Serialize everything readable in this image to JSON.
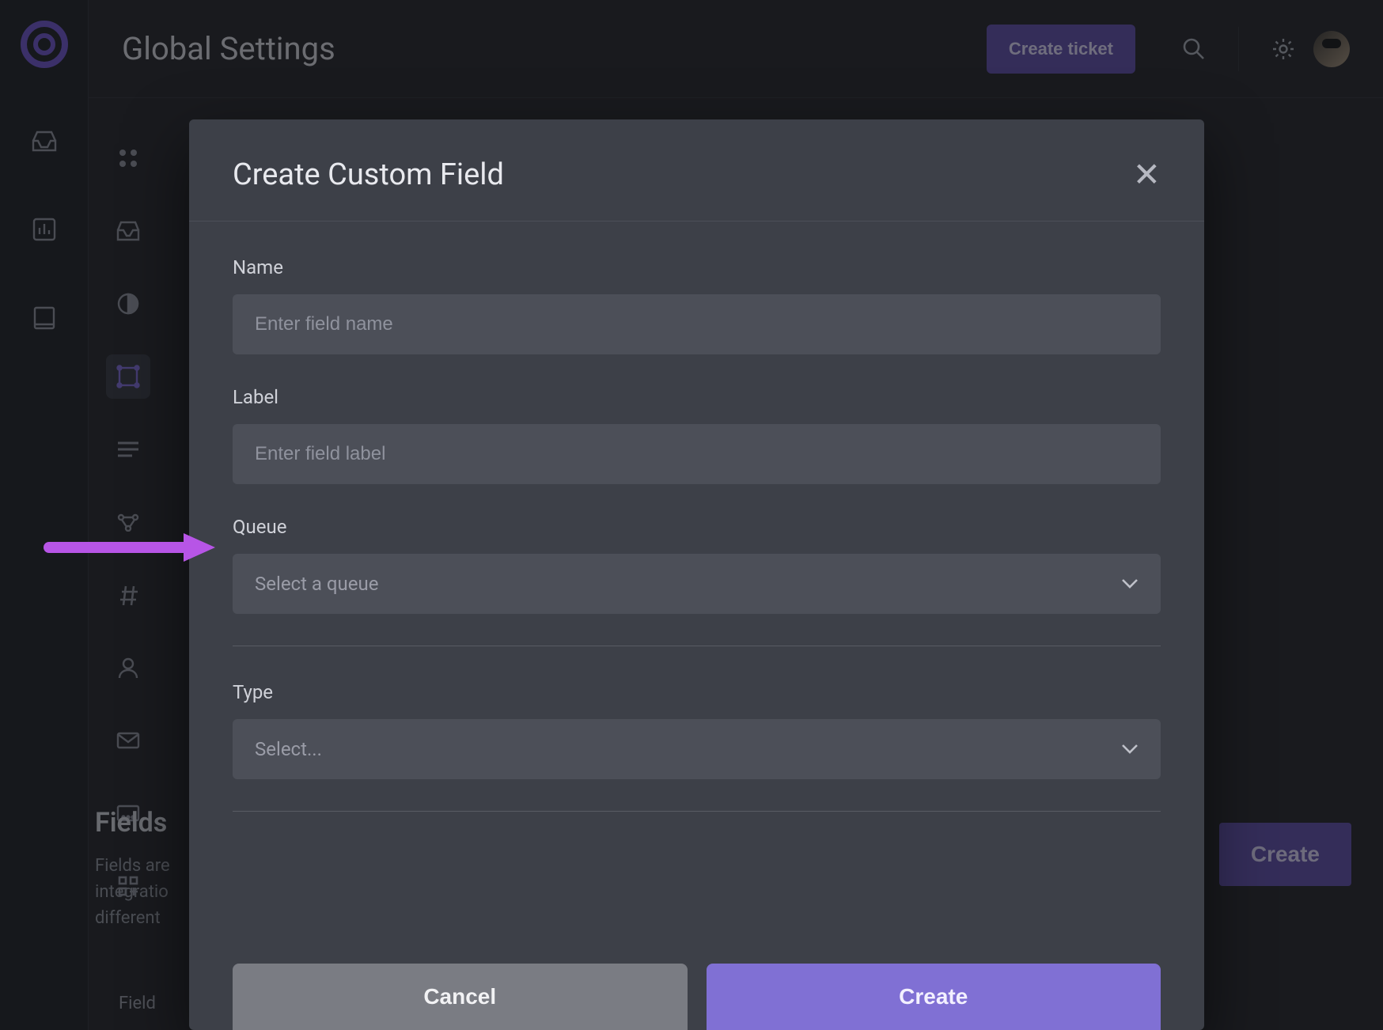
{
  "header": {
    "page_title": "Global Settings",
    "create_ticket_label": "Create ticket"
  },
  "background_page": {
    "section_title": "Fields",
    "section_body_line1": "Fields are",
    "section_body_line2": "integratio",
    "section_body_line3": "different",
    "create_button_label": "Create",
    "table_first_col": "Field"
  },
  "settings_nav_icons": [
    "apps-icon",
    "tray-icon",
    "contrast-icon",
    "fields-icon",
    "list-icon",
    "workflow-icon",
    "hash-icon",
    "user-icon",
    "mail-icon",
    "form-icon",
    "add-app-icon"
  ],
  "modal": {
    "title": "Create Custom Field",
    "labels": {
      "name": "Name",
      "label": "Label",
      "queue": "Queue",
      "type": "Type"
    },
    "placeholders": {
      "name": "Enter field name",
      "label": "Enter field label",
      "queue": "Select a queue",
      "type": "Select..."
    },
    "values": {
      "name": "",
      "label": "",
      "queue": "",
      "type": ""
    },
    "buttons": {
      "cancel": "Cancel",
      "create": "Create"
    }
  },
  "annotation": {
    "points_to": "queue-field",
    "color": "#b755e6"
  }
}
